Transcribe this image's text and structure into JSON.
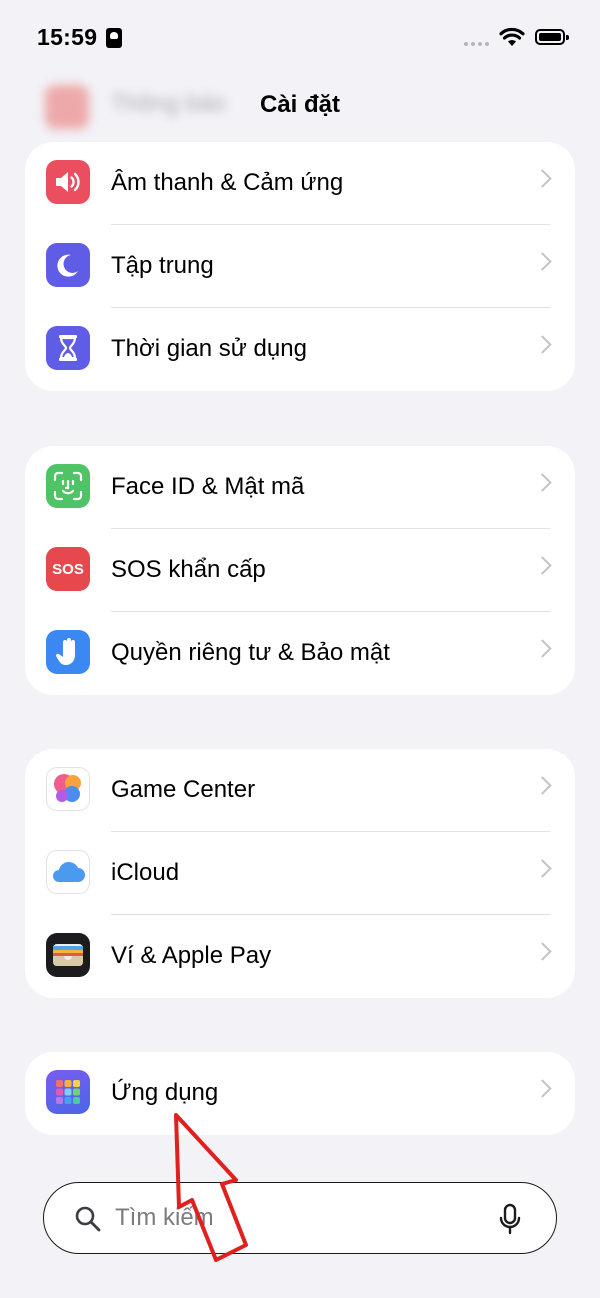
{
  "status_bar": {
    "time": "15:59"
  },
  "nav": {
    "title": "Cài đặt",
    "ghost_label": "Thông báo"
  },
  "groups": [
    {
      "rows": [
        {
          "label": "Âm thanh & Cảm ứng",
          "icon": "speaker-icon",
          "color": "#eb4e5f"
        },
        {
          "label": "Tập trung",
          "icon": "moon-icon",
          "color": "#5f5ce6"
        },
        {
          "label": "Thời gian sử dụng",
          "icon": "hourglass-icon",
          "color": "#5f5ce6"
        }
      ]
    },
    {
      "rows": [
        {
          "label": "Face ID & Mật mã",
          "icon": "face-id-icon",
          "color": "#4fc466"
        },
        {
          "label": "SOS khẩn cấp",
          "icon": "sos-icon",
          "color": "#e5484d",
          "icon_text": "SOS"
        },
        {
          "label": "Quyền riêng tư & Bảo mật",
          "icon": "hand-icon",
          "color": "#3b88f3"
        }
      ]
    },
    {
      "rows": [
        {
          "label": "Game Center",
          "icon": "game-center-icon",
          "color": "#ffffff"
        },
        {
          "label": "iCloud",
          "icon": "cloud-icon",
          "color": "#ffffff"
        },
        {
          "label": "Ví & Apple Pay",
          "icon": "wallet-icon",
          "color": "#1c1c1e"
        }
      ]
    },
    {
      "rows": [
        {
          "label": "Ứng dụng",
          "icon": "apps-grid-icon",
          "color": "#5b5ce6"
        }
      ]
    }
  ],
  "search": {
    "placeholder": "Tìm kiếm"
  },
  "annotation": {
    "arrow_color": "#e0201c"
  }
}
